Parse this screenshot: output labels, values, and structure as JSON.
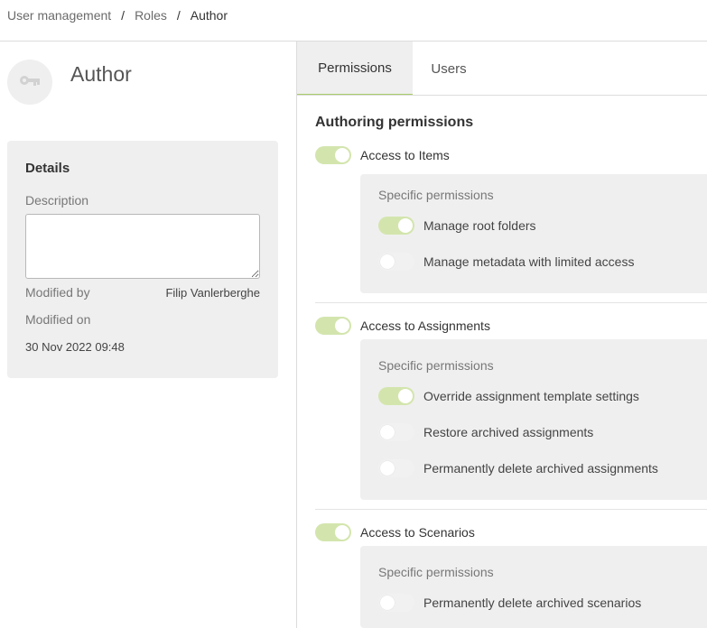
{
  "breadcrumb": {
    "items": [
      "User management",
      "Roles",
      "Author"
    ],
    "separator": "/"
  },
  "role": {
    "name": "Author",
    "avatar_icon": "key-icon"
  },
  "details": {
    "title": "Details",
    "description_label": "Description",
    "description_value": "",
    "modified_by_label": "Modified by",
    "modified_by_value": "Filip Vanlerberghe",
    "modified_on_label": "Modified on",
    "modified_on_value": "30 Nov 2022 09:48"
  },
  "tabs": [
    {
      "label": "Permissions",
      "active": true
    },
    {
      "label": "Users",
      "active": false
    }
  ],
  "permissions": {
    "section_title": "Authoring permissions",
    "specific_label": "Specific permissions",
    "groups": [
      {
        "label": "Access to Items",
        "enabled": true,
        "specific": [
          {
            "label": "Manage root folders",
            "enabled": true
          },
          {
            "label": "Manage metadata with limited access",
            "enabled": false
          }
        ]
      },
      {
        "label": "Access to Assignments",
        "enabled": true,
        "specific": [
          {
            "label": "Override assignment template settings",
            "enabled": true
          },
          {
            "label": "Restore archived assignments",
            "enabled": false
          },
          {
            "label": "Permanently delete archived assignments",
            "enabled": false
          }
        ]
      },
      {
        "label": "Access to Scenarios",
        "enabled": true,
        "specific": [
          {
            "label": "Permanently delete archived scenarios",
            "enabled": false
          }
        ]
      }
    ]
  },
  "colors": {
    "toggle_on": "#d3e5ad",
    "toggle_off": "#f1f1f1",
    "tab_accent": "#a9cc6a",
    "card_bg": "#efefef"
  }
}
